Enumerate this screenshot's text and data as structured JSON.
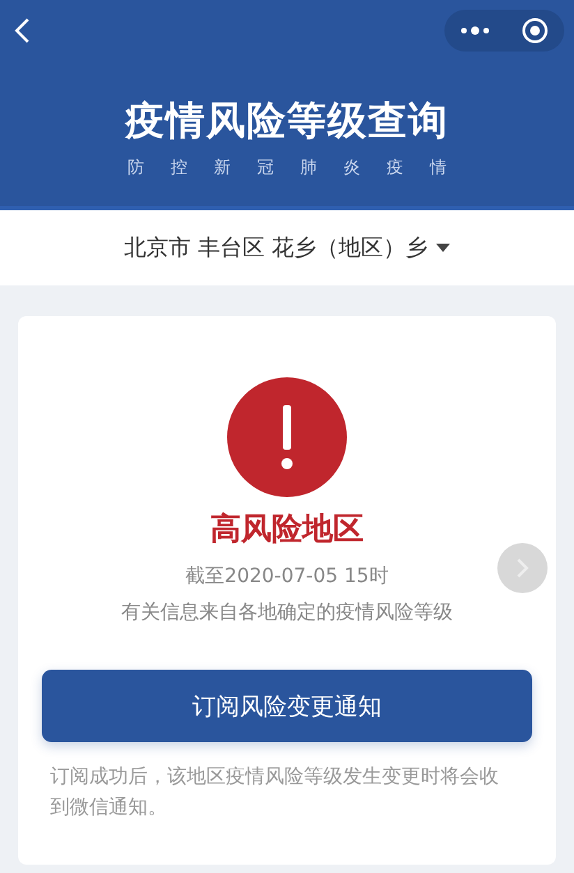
{
  "header": {
    "title": "疫情风险等级查询",
    "subtitle": [
      "防",
      "控",
      "新",
      "冠",
      "肺",
      "炎",
      "疫",
      "情"
    ]
  },
  "location": {
    "text": "北京市 丰台区 花乡（地区）乡"
  },
  "result": {
    "level": "高风险地区",
    "date": "截至2020-07-05 15时",
    "source": "有关信息来自各地确定的疫情风险等级",
    "color": "#c0262d"
  },
  "subscribe_button": "订阅风险变更通知",
  "note": "订阅成功后，该地区疫情风险等级发生变更时将会收到微信通知。"
}
